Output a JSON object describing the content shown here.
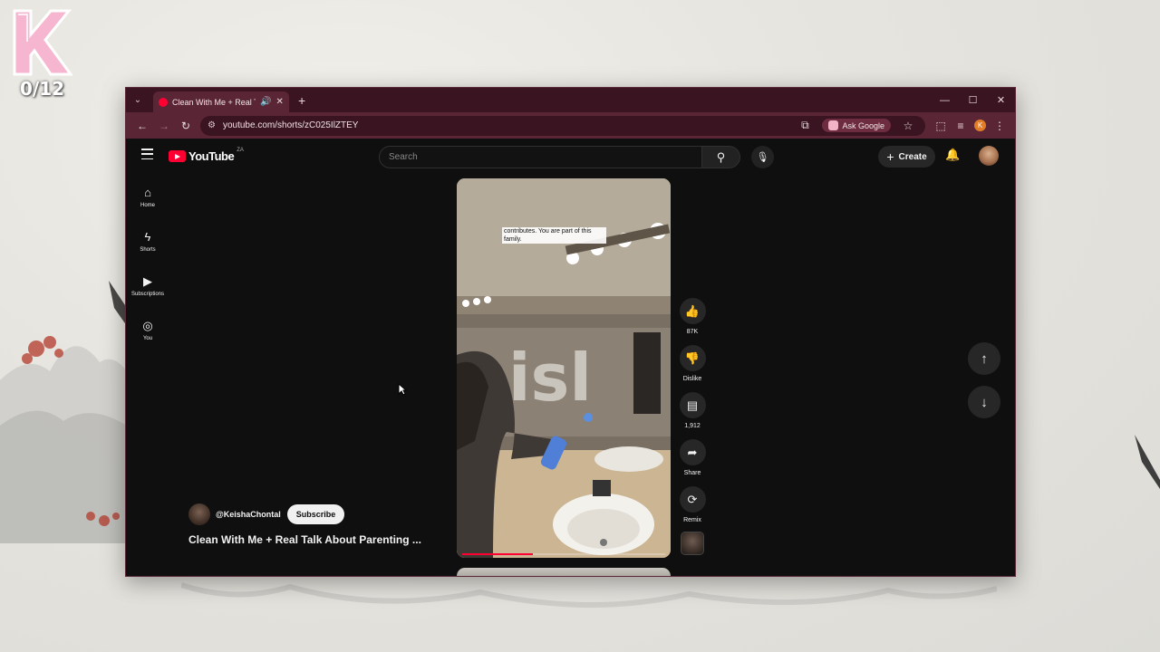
{
  "overlay": {
    "logo_letter": "K",
    "counter": "0/12"
  },
  "browser": {
    "tab": {
      "title": "Clean With Me + Real Talk A",
      "audio_icon": "speaker-icon"
    },
    "address": "youtube.com/shorts/zC025IlZTEY",
    "ask_google_label": "Ask Google",
    "profile_initial": "K",
    "accent": "#5a2535"
  },
  "youtube": {
    "logo_text": "YouTube",
    "country_code": "ZA",
    "search_placeholder": "Search",
    "create_label": "Create",
    "guide": [
      {
        "label": "Home",
        "icon": "home-icon"
      },
      {
        "label": "Shorts",
        "icon": "shorts-icon"
      },
      {
        "label": "Subscriptions",
        "icon": "subscriptions-icon"
      },
      {
        "label": "You",
        "icon": "you-icon"
      }
    ],
    "short": {
      "caption": "contributes. You are part of this family.",
      "channel": "@KeishaChontal",
      "subscribe_label": "Subscribe",
      "title": "Clean With Me + Real Talk About Parenting ...",
      "progress": 0.35
    },
    "actions": [
      {
        "label": "87K",
        "icon": "like-icon"
      },
      {
        "label": "Dislike",
        "icon": "dislike-icon"
      },
      {
        "label": "1,912",
        "icon": "comment-icon"
      },
      {
        "label": "Share",
        "icon": "share-icon"
      },
      {
        "label": "Remix",
        "icon": "remix-icon"
      }
    ],
    "brand_color": "#ff0033"
  }
}
